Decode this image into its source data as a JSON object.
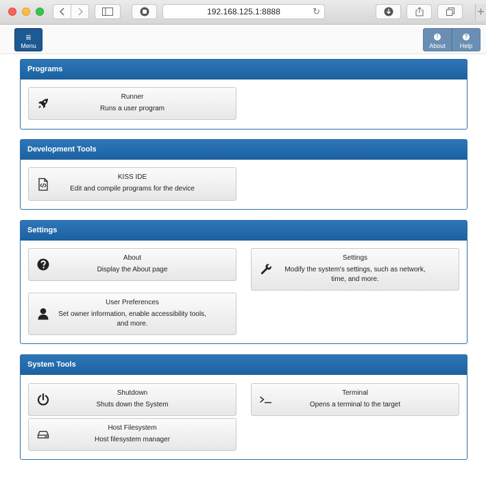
{
  "browser": {
    "url": "192.168.125.1:8888",
    "newtab_label": "+"
  },
  "header": {
    "menu_label": "Menu",
    "about_label": "About",
    "help_label": "Help"
  },
  "sections": {
    "programs": {
      "title": "Programs",
      "runner": {
        "title": "Runner",
        "desc": "Runs a user program"
      }
    },
    "devtools": {
      "title": "Development Tools",
      "kiss_ide": {
        "title": "KISS IDE",
        "desc": "Edit and compile programs for the device"
      }
    },
    "settings": {
      "title": "Settings",
      "about": {
        "title": "About",
        "desc": "Display the About page"
      },
      "settings": {
        "title": "Settings",
        "desc": "Modify the system's settings, such as network, time, and more."
      },
      "user_prefs": {
        "title": "User Preferences",
        "desc": "Set owner information, enable accessibility tools, and more."
      }
    },
    "system_tools": {
      "title": "System Tools",
      "shutdown": {
        "title": "Shutdown",
        "desc": "Shuts down the System"
      },
      "terminal": {
        "title": "Terminal",
        "desc": "Opens a terminal to the target"
      },
      "host_fs": {
        "title": "Host Filesystem",
        "desc": "Host filesystem manager"
      }
    }
  },
  "icons": {
    "runner": "rocket-icon",
    "kiss_ide": "code-file-icon",
    "about": "question-circle-icon",
    "settings": "wrench-icon",
    "user_prefs": "user-icon",
    "shutdown": "power-icon",
    "terminal": "terminal-icon",
    "host_fs": "hard-drive-icon"
  },
  "colors": {
    "panel_header": "#1f67a6",
    "menu_button": "#1d5a93",
    "header_button": "#6a8fb2"
  }
}
